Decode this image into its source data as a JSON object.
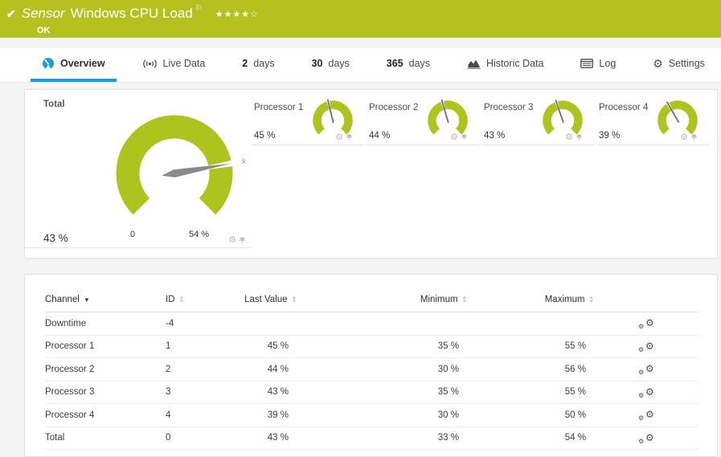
{
  "colors": {
    "header_bg": "#b4c11e",
    "gauge_green": "#adc41e",
    "accent_blue": "#1d9bd7",
    "needle_gray": "#8a8a8a",
    "mini_needle": "#6e6e6e"
  },
  "icons": {
    "check": "✔",
    "flag": "⚐",
    "gear": "⚙",
    "sort_desc": "▼",
    "sort_up": "▲",
    "sort_down": "▼",
    "avg_marker": "x̄"
  },
  "header": {
    "kind_label": "Sensor",
    "title": "Windows CPU Load",
    "status": "OK",
    "stars_filled": "★★★★",
    "star_empty": "☆"
  },
  "tabs": [
    {
      "label": "Overview",
      "active": true
    },
    {
      "label": "Live Data"
    },
    {
      "value": "2",
      "label": "days"
    },
    {
      "value": "30",
      "label": "days"
    },
    {
      "value": "365",
      "label": "days"
    },
    {
      "label": "Historic Data"
    },
    {
      "label": "Log"
    },
    {
      "label": "Settings"
    }
  ],
  "gauges": {
    "total": {
      "label": "Total",
      "value": 43,
      "value_label": "43 %",
      "scale_min": 0,
      "scale_max": 54,
      "scale_min_label": "0",
      "scale_max_label": "54 %"
    },
    "minis": [
      {
        "label": "Processor 1",
        "value": 45,
        "value_label": "45 %"
      },
      {
        "label": "Processor 2",
        "value": 44,
        "value_label": "44 %"
      },
      {
        "label": "Processor 3",
        "value": 43,
        "value_label": "43 %"
      },
      {
        "label": "Processor 4",
        "value": 39,
        "value_label": "39 %"
      }
    ]
  },
  "table": {
    "headers": {
      "channel": "Channel",
      "id": "ID",
      "last": "Last Value",
      "min": "Minimum",
      "max": "Maximum"
    },
    "rows": [
      {
        "channel": "Downtime",
        "id": "-4",
        "last": "",
        "min": "",
        "max": ""
      },
      {
        "channel": "Processor 1",
        "id": "1",
        "last": "45 %",
        "min": "35 %",
        "max": "55 %"
      },
      {
        "channel": "Processor 2",
        "id": "2",
        "last": "44 %",
        "min": "30 %",
        "max": "56 %"
      },
      {
        "channel": "Processor 3",
        "id": "3",
        "last": "43 %",
        "min": "35 %",
        "max": "55 %"
      },
      {
        "channel": "Processor 4",
        "id": "4",
        "last": "39 %",
        "min": "30 %",
        "max": "50 %"
      },
      {
        "channel": "Total",
        "id": "0",
        "last": "43 %",
        "min": "33 %",
        "max": "54 %"
      }
    ]
  }
}
